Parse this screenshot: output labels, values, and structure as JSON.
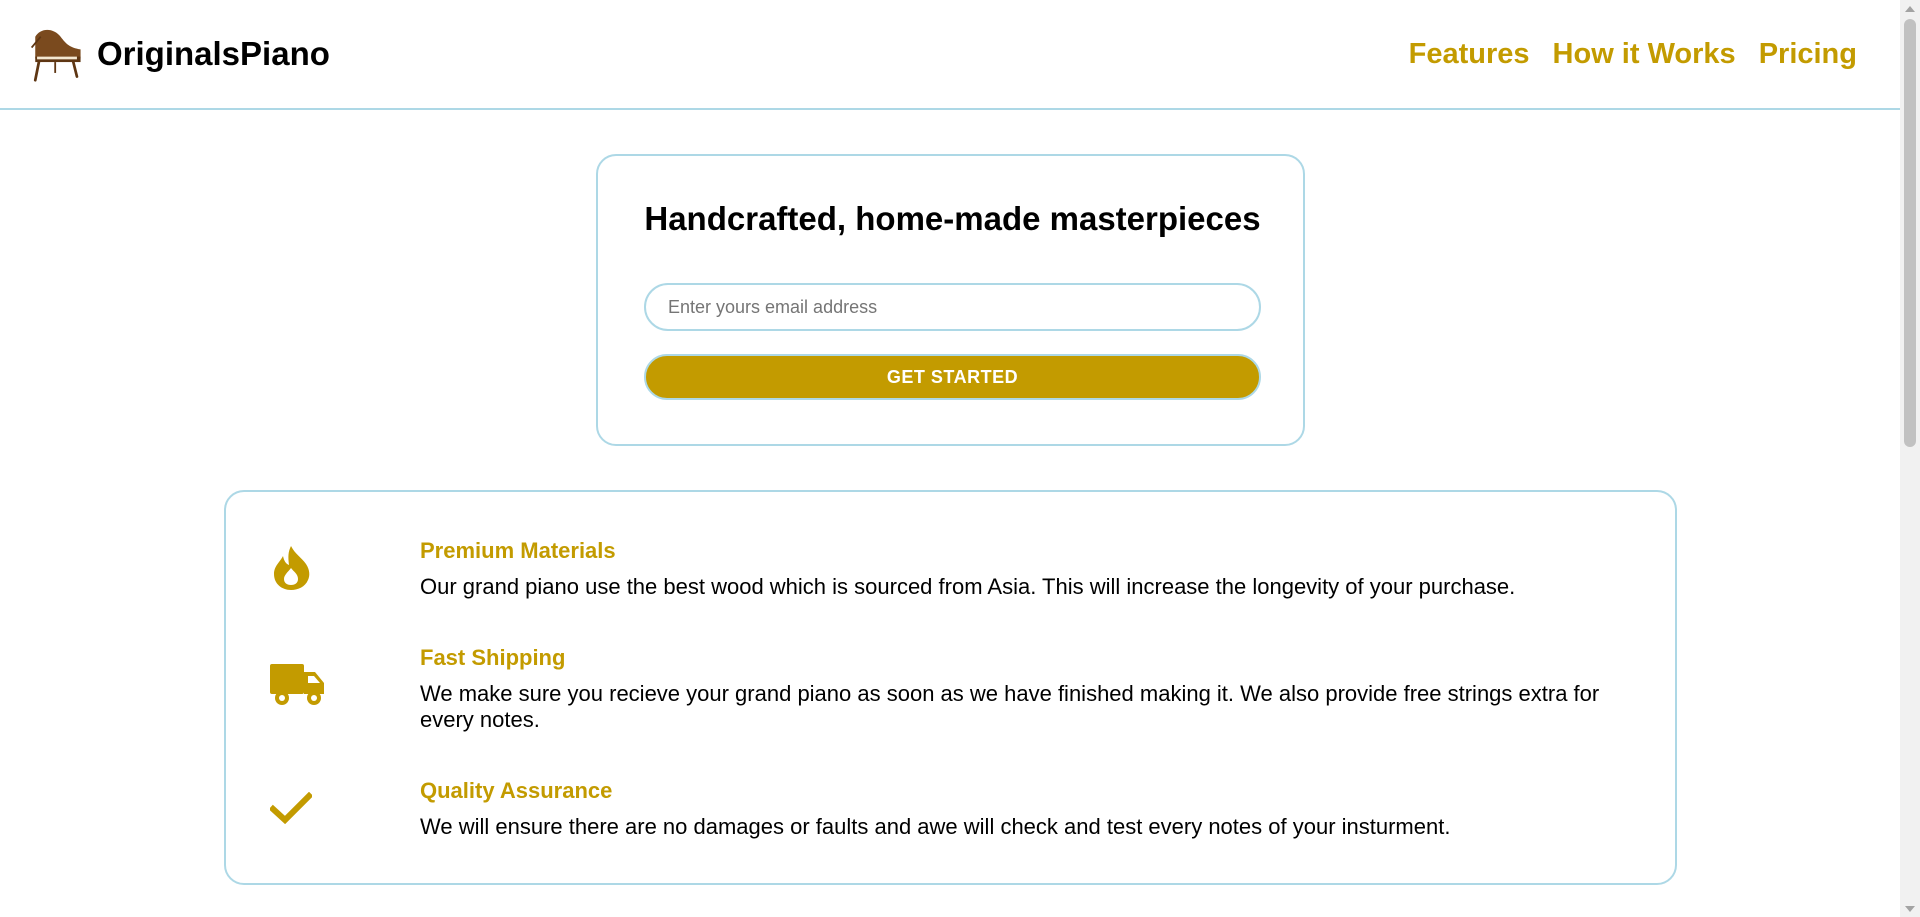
{
  "header": {
    "brand_name": "OriginalsPiano",
    "logo_icon": "grand-piano-icon",
    "nav": [
      {
        "label": "Features"
      },
      {
        "label": "How it Works"
      },
      {
        "label": "Pricing"
      }
    ]
  },
  "signup": {
    "title": "Handcrafted, home-made masterpieces",
    "email_placeholder": "Enter yours email address",
    "email_value": "",
    "button_label": "GET STARTED"
  },
  "features": [
    {
      "icon": "fire-icon",
      "title": "Premium Materials",
      "description": "Our grand piano use the best wood which is sourced from Asia. This will increase the longevity of your purchase."
    },
    {
      "icon": "truck-icon",
      "title": "Fast Shipping",
      "description": "We make sure you recieve your grand piano as soon as we have finished making it. We also provide free strings extra for every notes."
    },
    {
      "icon": "check-icon",
      "title": "Quality Assurance",
      "description": "We will ensure there are no damages or faults and awe will check and test every notes of your insturment."
    }
  ],
  "colors": {
    "accent": "#c39b00",
    "border": "#add8e6",
    "logo": "#7a4a1e",
    "text": "#000000",
    "button_text": "#ffffff"
  }
}
